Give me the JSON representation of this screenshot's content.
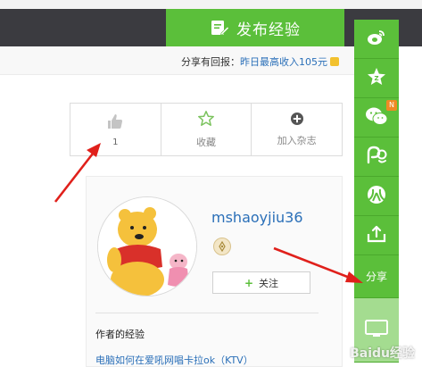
{
  "header": {
    "publish_label": "发布经验"
  },
  "infobar": {
    "prefix": "分享有回报：",
    "highlight": "昨日最高收入105元"
  },
  "actions": [
    {
      "name": "like",
      "label": "",
      "count": "1"
    },
    {
      "name": "collect",
      "label": "收藏"
    },
    {
      "name": "add-to-magazine",
      "label": "加入杂志"
    }
  ],
  "author": {
    "name": "mshaoyjiu36",
    "follow_label": "关注",
    "experience_title": "作者的经验",
    "experience_link": "电脑如何在爱吼网唱卡拉ok（KTV）"
  },
  "sidebar": {
    "items": [
      {
        "icon": "weibo-icon"
      },
      {
        "icon": "qzone-star-icon"
      },
      {
        "icon": "wechat-icon",
        "badge": "N"
      },
      {
        "icon": "tieba-icon"
      },
      {
        "icon": "renren-icon"
      },
      {
        "icon": "share-upload-icon"
      }
    ],
    "share_label": "分享"
  },
  "watermark": "Baidu经验",
  "colors": {
    "green": "#5bbf3a",
    "link": "#2a6fb8",
    "arrow": "#e0201b"
  }
}
